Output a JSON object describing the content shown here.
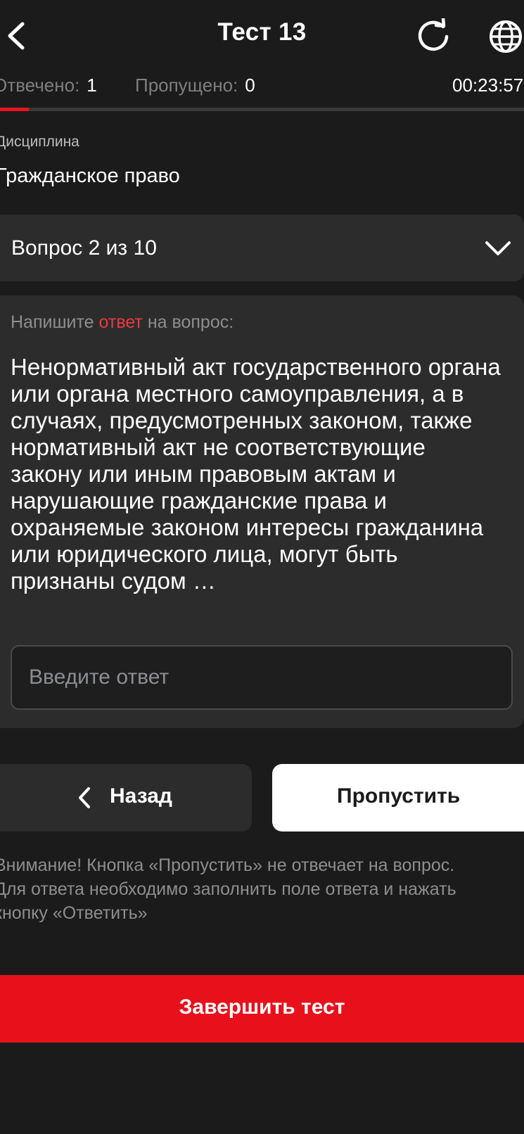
{
  "colors": {
    "background": "#1b1b1b",
    "surface": "#2c2c2c",
    "accent": "#e8111b",
    "muted_text": "#8e8e8e"
  },
  "header": {
    "title": "Тест 13",
    "icons": {
      "back": "chevron-left-icon",
      "refresh": "refresh-icon",
      "language": "globe-icon"
    }
  },
  "stats": {
    "answered_label": "Отвечено:",
    "answered_value": "1",
    "skipped_label": "Пропущено:",
    "skipped_value": "0",
    "timer": "00:23:57"
  },
  "progress": {
    "fraction": 0.055
  },
  "discipline": {
    "label": "Дисциплина",
    "value": "Гражданское право"
  },
  "question_selector": {
    "label": "Вопрос 2 из 10"
  },
  "question_card": {
    "prompt_prefix": "Напишите",
    "prompt_accent": "ответ",
    "prompt_suffix": "на вопрос:",
    "text": "Ненормативный акт государственного органа или органа местного самоуправления, а в случаях, предусмотренных законом, также нормативный акт не соответствующие закону или иным правовым актам и нарушающие гражданские права и охраняемые законом интересы гражданина или юридического лица, могут быть признаны судом …",
    "answer_placeholder": "Введите ответ",
    "answer_value": ""
  },
  "buttons": {
    "back_label": "Назад",
    "skip_label": "Пропустить",
    "finish_label": "Завершить тест"
  },
  "notice": {
    "line1": "Внимание! Кнопка «Пропустить» не отвечает на вопрос.",
    "line2": "Для ответа необходимо заполнить поле ответа и нажать",
    "line3": "кнопку «Ответить»"
  }
}
